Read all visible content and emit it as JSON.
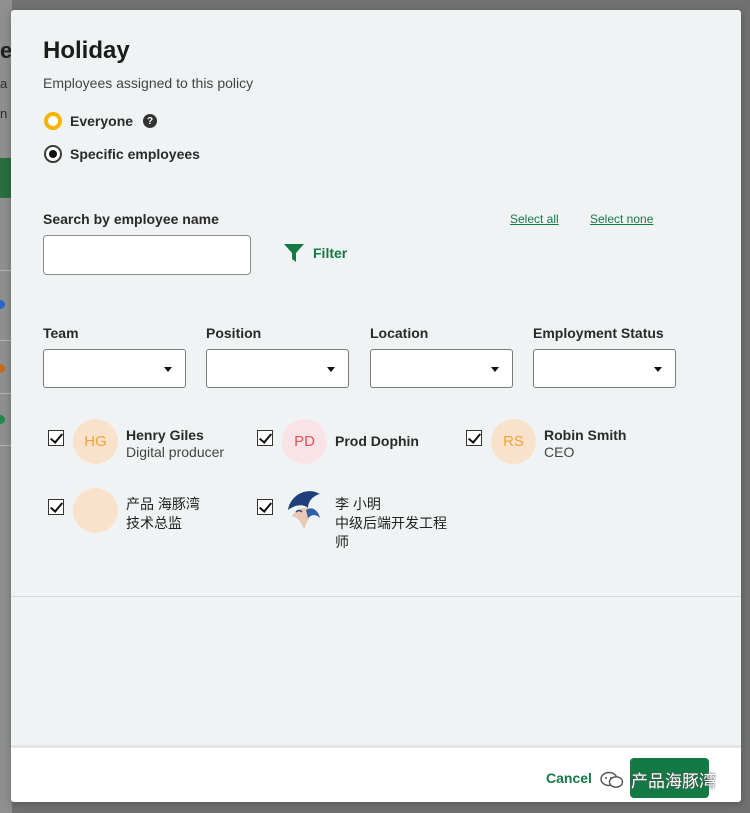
{
  "background": {
    "fragments": [
      "e",
      "a",
      "n"
    ]
  },
  "modal": {
    "title": "Holiday",
    "subtitle": "Employees assigned to this policy",
    "radios": [
      {
        "label": "Everyone",
        "checked": false
      },
      {
        "label": "Specific employees",
        "checked": true
      }
    ],
    "search": {
      "label": "Search by employee name",
      "value": "",
      "placeholder": ""
    },
    "select_all_label": "Select all",
    "select_none_label": "Select none",
    "filter_label": "Filter",
    "filters": [
      {
        "label": "Team",
        "value": ""
      },
      {
        "label": "Position",
        "value": ""
      },
      {
        "label": "Location",
        "value": ""
      },
      {
        "label": "Employment Status",
        "value": ""
      }
    ],
    "employees": [
      {
        "initials": "HG",
        "name": "Henry Giles",
        "position": "Digital producer",
        "checked": true
      },
      {
        "initials": "PD",
        "name": "Prod Dophin",
        "position": "",
        "checked": true
      },
      {
        "initials": "RS",
        "name": "Robin Smith",
        "position": "CEO",
        "checked": true
      },
      {
        "initials": "",
        "name": "产品 海豚湾",
        "position": "技术总监",
        "checked": true
      },
      {
        "initials": "",
        "name": "李 小明",
        "position": "中级后端开发工程师",
        "checked": true
      }
    ],
    "footer": {
      "cancel_label": "Cancel",
      "watermark": "产品海豚湾"
    }
  },
  "colors": {
    "accent": "#137a45",
    "focus_ring": "#f5b400",
    "modal_bg": "#f0f3f4"
  }
}
